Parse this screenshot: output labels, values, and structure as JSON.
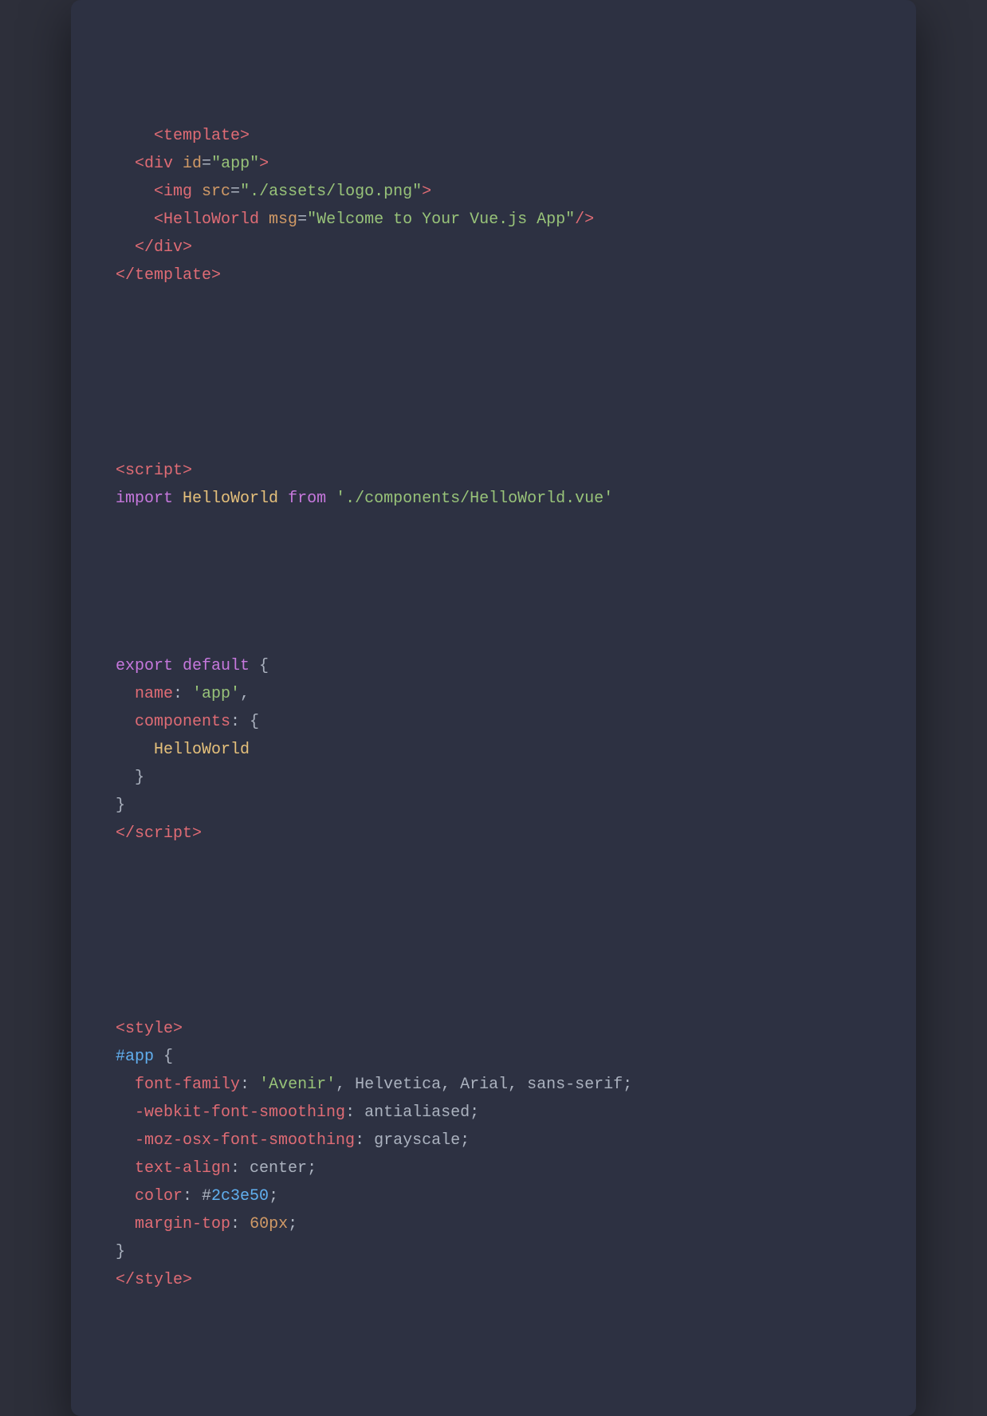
{
  "window": {
    "background": "#2d3142",
    "border_radius": "12px"
  },
  "code": {
    "lines": [
      "line_template",
      "line_div_open",
      "line_img",
      "line_helloworld_tag",
      "line_div_close",
      "line_template_close",
      "blank",
      "line_script_open",
      "line_import",
      "blank",
      "line_export_default",
      "line_name",
      "line_components",
      "line_helloworld_ident",
      "line_components_close",
      "line_export_close",
      "line_script_close",
      "blank",
      "line_style_open",
      "line_app_selector",
      "line_font_family",
      "line_webkit",
      "line_moz",
      "line_text_align",
      "line_color",
      "line_margin_top",
      "line_style_body_close",
      "line_style_close"
    ]
  }
}
